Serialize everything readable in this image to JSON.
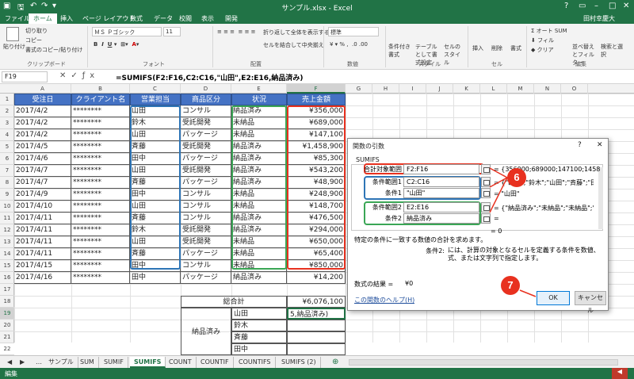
{
  "window": {
    "title": "サンプル.xlsx - Excel",
    "user": "田村幸慶大"
  },
  "ribbon_tabs": [
    "ファイル",
    "ホーム",
    "挿入",
    "ページ レイアウト",
    "数式",
    "データ",
    "校閲",
    "表示",
    "開発"
  ],
  "ribbon": {
    "paste": "貼り付け",
    "cut": "切り取り",
    "copy": "コピー",
    "format_painter": "書式のコピー/貼り付け",
    "clipboard": "クリップボード",
    "font": "フォント",
    "font_name": "ＭＳ Ｐゴシック",
    "font_size": "11",
    "wrap_text": "折り返して全体を表示する",
    "merge_center": "セルを結合して中央揃え",
    "alignment": "配置",
    "number_format": "標準",
    "number": "数値",
    "conditional": "条件付き書式",
    "table_format": "テーブルとして書式設定",
    "cell_style": "セルのスタイル",
    "styles": "スタイル",
    "insert": "挿入",
    "delete": "削除",
    "format": "書式",
    "cells": "セル",
    "autosum": "オート SUM",
    "fill": "フィル",
    "clear": "クリア",
    "sort_filter": "並べ替えとフィルター",
    "find_select": "検索と選択",
    "editing": "編集"
  },
  "formula_bar": {
    "name_box": "F19",
    "formula": "=SUMIFS(F2:F16,C2:C16,\"山田\",E2:E16,納品済み)"
  },
  "columns": [
    "A",
    "B",
    "C",
    "D",
    "E",
    "F",
    "G",
    "H",
    "I",
    "J",
    "K",
    "L",
    "M",
    "N",
    "O"
  ],
  "rows": [
    "1",
    "2",
    "3",
    "4",
    "5",
    "6",
    "7",
    "8",
    "9",
    "10",
    "11",
    "12",
    "13",
    "14",
    "15",
    "16",
    "17",
    "18",
    "19",
    "20",
    "21",
    "22"
  ],
  "table": {
    "headers": [
      "受注日",
      "クライアント名",
      "営業担当",
      "商品区分",
      "状況",
      "売上金額"
    ],
    "rows": [
      [
        "2017/4/2",
        "********",
        "山田",
        "コンサル",
        "納品済み",
        "¥356,000"
      ],
      [
        "2017/4/2",
        "********",
        "鈴木",
        "受託開発",
        "未納品",
        "¥689,000"
      ],
      [
        "2017/4/2",
        "********",
        "山田",
        "パッケージ",
        "未納品",
        "¥147,100"
      ],
      [
        "2017/4/5",
        "********",
        "斉藤",
        "受託開発",
        "納品済み",
        "¥1,458,900"
      ],
      [
        "2017/4/6",
        "********",
        "田中",
        "パッケージ",
        "納品済み",
        "¥85,300"
      ],
      [
        "2017/4/7",
        "********",
        "山田",
        "受託開発",
        "納品済み",
        "¥543,200"
      ],
      [
        "2017/4/7",
        "********",
        "斉藤",
        "パッケージ",
        "納品済み",
        "¥48,900"
      ],
      [
        "2017/4/9",
        "********",
        "田中",
        "コンサル",
        "未納品",
        "¥248,900"
      ],
      [
        "2017/4/10",
        "********",
        "山田",
        "コンサル",
        "未納品",
        "¥148,700"
      ],
      [
        "2017/4/11",
        "********",
        "斉藤",
        "コンサル",
        "納品済み",
        "¥476,500"
      ],
      [
        "2017/4/11",
        "********",
        "鈴木",
        "受託開発",
        "納品済み",
        "¥294,000"
      ],
      [
        "2017/4/11",
        "********",
        "山田",
        "受託開発",
        "未納品",
        "¥650,000"
      ],
      [
        "2017/4/11",
        "********",
        "斉藤",
        "パッケージ",
        "未納品",
        "¥65,400"
      ],
      [
        "2017/4/15",
        "********",
        "田中",
        "コンサル",
        "未納品",
        "¥850,000"
      ],
      [
        "2017/4/16",
        "********",
        "田中",
        "パッケージ",
        "納品済み",
        "¥14,200"
      ]
    ]
  },
  "summary": {
    "total_label": "総合計",
    "total_value": "¥6,076,100",
    "group_label": "納品済み",
    "names": [
      "山田",
      "鈴木",
      "斉藤",
      "田中"
    ],
    "editing_value": "5,納品済み)"
  },
  "dialog": {
    "title": "関数の引数",
    "function_name": "SUMIFS",
    "args": [
      {
        "label": "合計対象範囲",
        "value": "F2:F16",
        "result": "= {356000;689000;147100;14589..."
      },
      {
        "label": "条件範囲1",
        "value": "C2:C16",
        "result": "= {\"山田\";\"鈴木\";\"山田\";\"斉藤\";\"田..."
      },
      {
        "label": "条件1",
        "value": "\"山田\"",
        "result": "= \"山田\""
      },
      {
        "label": "条件範囲2",
        "value": "E2:E16",
        "result": "= {\"納品済み\";\"未納品\";\"未納品\";\"納品..."
      },
      {
        "label": "条件2",
        "value": "納品済み",
        "result": "="
      }
    ],
    "eq_zero": "= 0",
    "description": "特定の条件に一致する数値の合計を求めます。",
    "arg_help_label": "条件2:",
    "arg_help": "には、計算の対象となるセルを定義する条件を数値、式、または文字列で指定します。",
    "result_label": "数式の結果 =",
    "result_value": "¥0",
    "help_link": "この関数のヘルプ(H)",
    "ok": "OK",
    "cancel": "キャンセル"
  },
  "callouts": [
    "6",
    "7"
  ],
  "sheet_tabs": [
    "サンプル",
    "SUM",
    "SUMIF",
    "SUMIFS",
    "COUNT",
    "COUNTIF",
    "COUNTIFS",
    "SUMIFS (2)"
  ],
  "active_sheet": "SUMIFS",
  "status": "編集",
  "colors": {
    "excel_green": "#217346",
    "header_blue": "#4472c4",
    "callout_red": "#e8311f"
  }
}
